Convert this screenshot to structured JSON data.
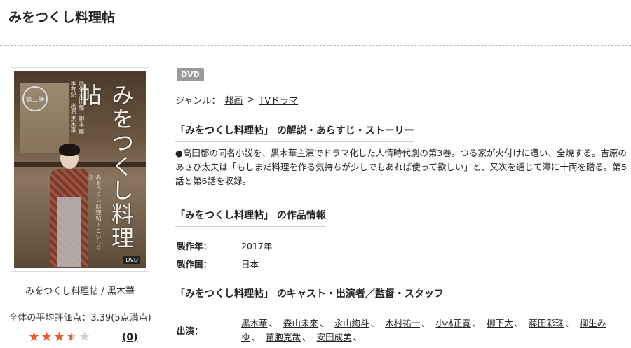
{
  "page": {
    "title": "みをつくし料理帖"
  },
  "cover": {
    "badge_text": "第三巻",
    "title_text": "みをつくし料理帖",
    "credits_text": "原作 高田郁　脚本 藤本有紀　出演 黒木華",
    "sub_text": "みをつくし 料理帖 ─ こいしぐさ",
    "dvd_mark": "DVD"
  },
  "product": {
    "name": "みをつくし料理帖 / 黒木華",
    "avg_rating_text": "全体の平均評価点：3.39(5点満点)",
    "rating_value": 3.39,
    "rating_max": 5,
    "review_count": "(0)"
  },
  "format_badge": "DVD",
  "genre": {
    "label": "ジャンル：",
    "items": [
      "邦画",
      "TVドラマ"
    ],
    "separator": ">"
  },
  "sections": {
    "synopsis_heading": "「みをつくし料理帖」 の解説・あらすじ・ストーリー",
    "synopsis_text": "●高田郁の同名小説を、黒木華主演でドラマ化した人情時代劇の第3巻。つる家が火付けに遭い、全焼する。吉原のあさひ太夫は「もしまだ料理を作る気持ちが少しでもあれば使って欲しい」と、又次を通じて澪に十両を贈る。第5話と第6話を収録。",
    "info_heading": "「みをつくし料理帖」 の作品情報",
    "info_rows": [
      {
        "label": "製作年：",
        "value": "2017年"
      },
      {
        "label": "製作国：",
        "value": "日本"
      }
    ],
    "cast_heading": "「みをつくし料理帖」 のキャスト・出演者／監督・スタッフ",
    "cast_label": "出演：",
    "cast": [
      "黒木華",
      "森山未來",
      "永山絢斗",
      "木村祐一",
      "小林正寛",
      "柳下大",
      "藤田彩珠",
      "柳生みゆ",
      "苗胞克哉",
      "安田成美"
    ],
    "cast_separator": "、"
  },
  "colors": {
    "star_filled": "#e85d2c",
    "star_empty": "#cfcfcf",
    "badge_bg": "#9a9a9a"
  }
}
